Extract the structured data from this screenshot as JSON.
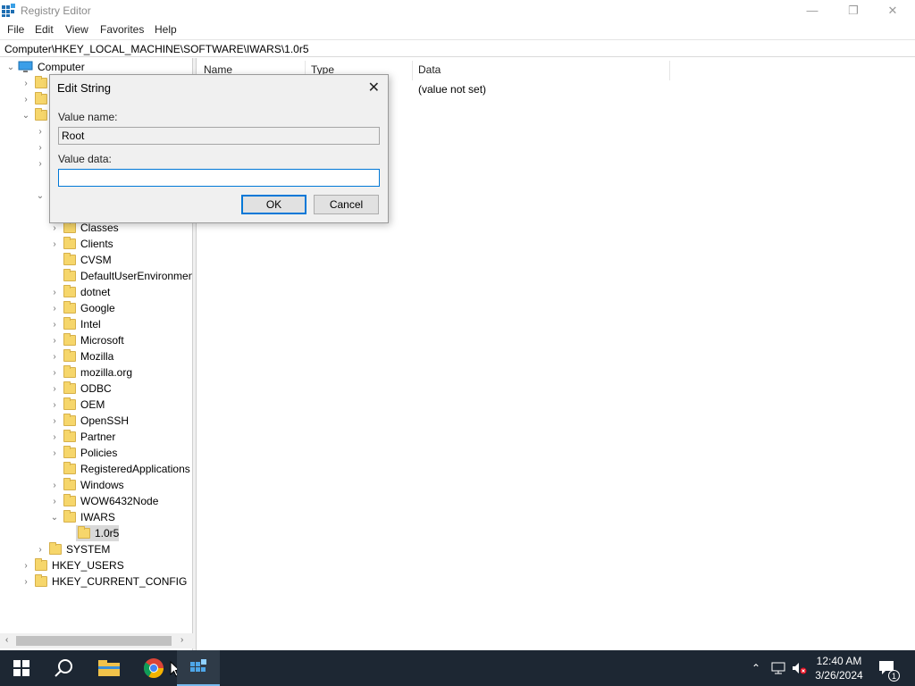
{
  "window": {
    "title": "Registry Editor",
    "minimize_glyph": "—",
    "restore_glyph": "❐",
    "close_glyph": "✕"
  },
  "menu": [
    "File",
    "Edit",
    "View",
    "Favorites",
    "Help"
  ],
  "address": "Computer\\HKEY_LOCAL_MACHINE\\SOFTWARE\\IWARS\\1.0r5",
  "tree": {
    "root": "Computer",
    "software_children": [
      "Classes",
      "Clients",
      "CVSM",
      "DefaultUserEnvironmen",
      "dotnet",
      "Google",
      "Intel",
      "Microsoft",
      "Mozilla",
      "mozilla.org",
      "ODBC",
      "OEM",
      "OpenSSH",
      "Partner",
      "Policies",
      "RegisteredApplications",
      "Windows",
      "WOW6432Node",
      "IWARS"
    ],
    "selected_key": "1.0r5",
    "system": "SYSTEM",
    "hkey_users": "HKEY_USERS",
    "hkey_current_config": "HKEY_CURRENT_CONFIG"
  },
  "list": {
    "columns": [
      "Name",
      "Type",
      "Data"
    ],
    "rows": [
      {
        "data": "(value not set)"
      }
    ]
  },
  "dialog": {
    "title": "Edit String",
    "value_name_label": "Value name:",
    "value_name": "Root",
    "value_data_label": "Value data:",
    "value_data": "",
    "ok": "OK",
    "cancel": "Cancel"
  },
  "taskbar": {
    "time": "12:40 AM",
    "date": "3/26/2024",
    "notifications": "1"
  },
  "colors": {
    "accent": "#0078d7",
    "taskbar": "#1d2733",
    "folder": "#f6d66b"
  }
}
